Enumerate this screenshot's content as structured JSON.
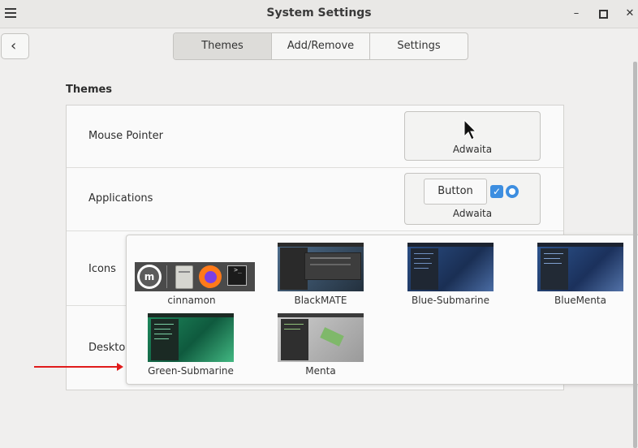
{
  "window": {
    "title": "System Settings",
    "minimize": "–",
    "maximize": "□",
    "close": "✕"
  },
  "tabs": [
    "Themes",
    "Add/Remove",
    "Settings"
  ],
  "section_title": "Themes",
  "rows": {
    "mouse_pointer": {
      "label": "Mouse Pointer",
      "value": "Adwaita"
    },
    "applications": {
      "label": "Applications",
      "value": "Adwaita",
      "button_label": "Button"
    },
    "icons": {
      "label": "Icons"
    },
    "desktop": {
      "label": "Desktop"
    }
  },
  "theme_options": [
    {
      "name": "cinnamon"
    },
    {
      "name": "BlackMATE"
    },
    {
      "name": "Blue-Submarine"
    },
    {
      "name": "BlueMenta"
    },
    {
      "name": "Green-Submarine"
    },
    {
      "name": "Menta"
    }
  ],
  "colors": {
    "accent": "#3d8ee0",
    "arrow": "#e01b1b"
  }
}
